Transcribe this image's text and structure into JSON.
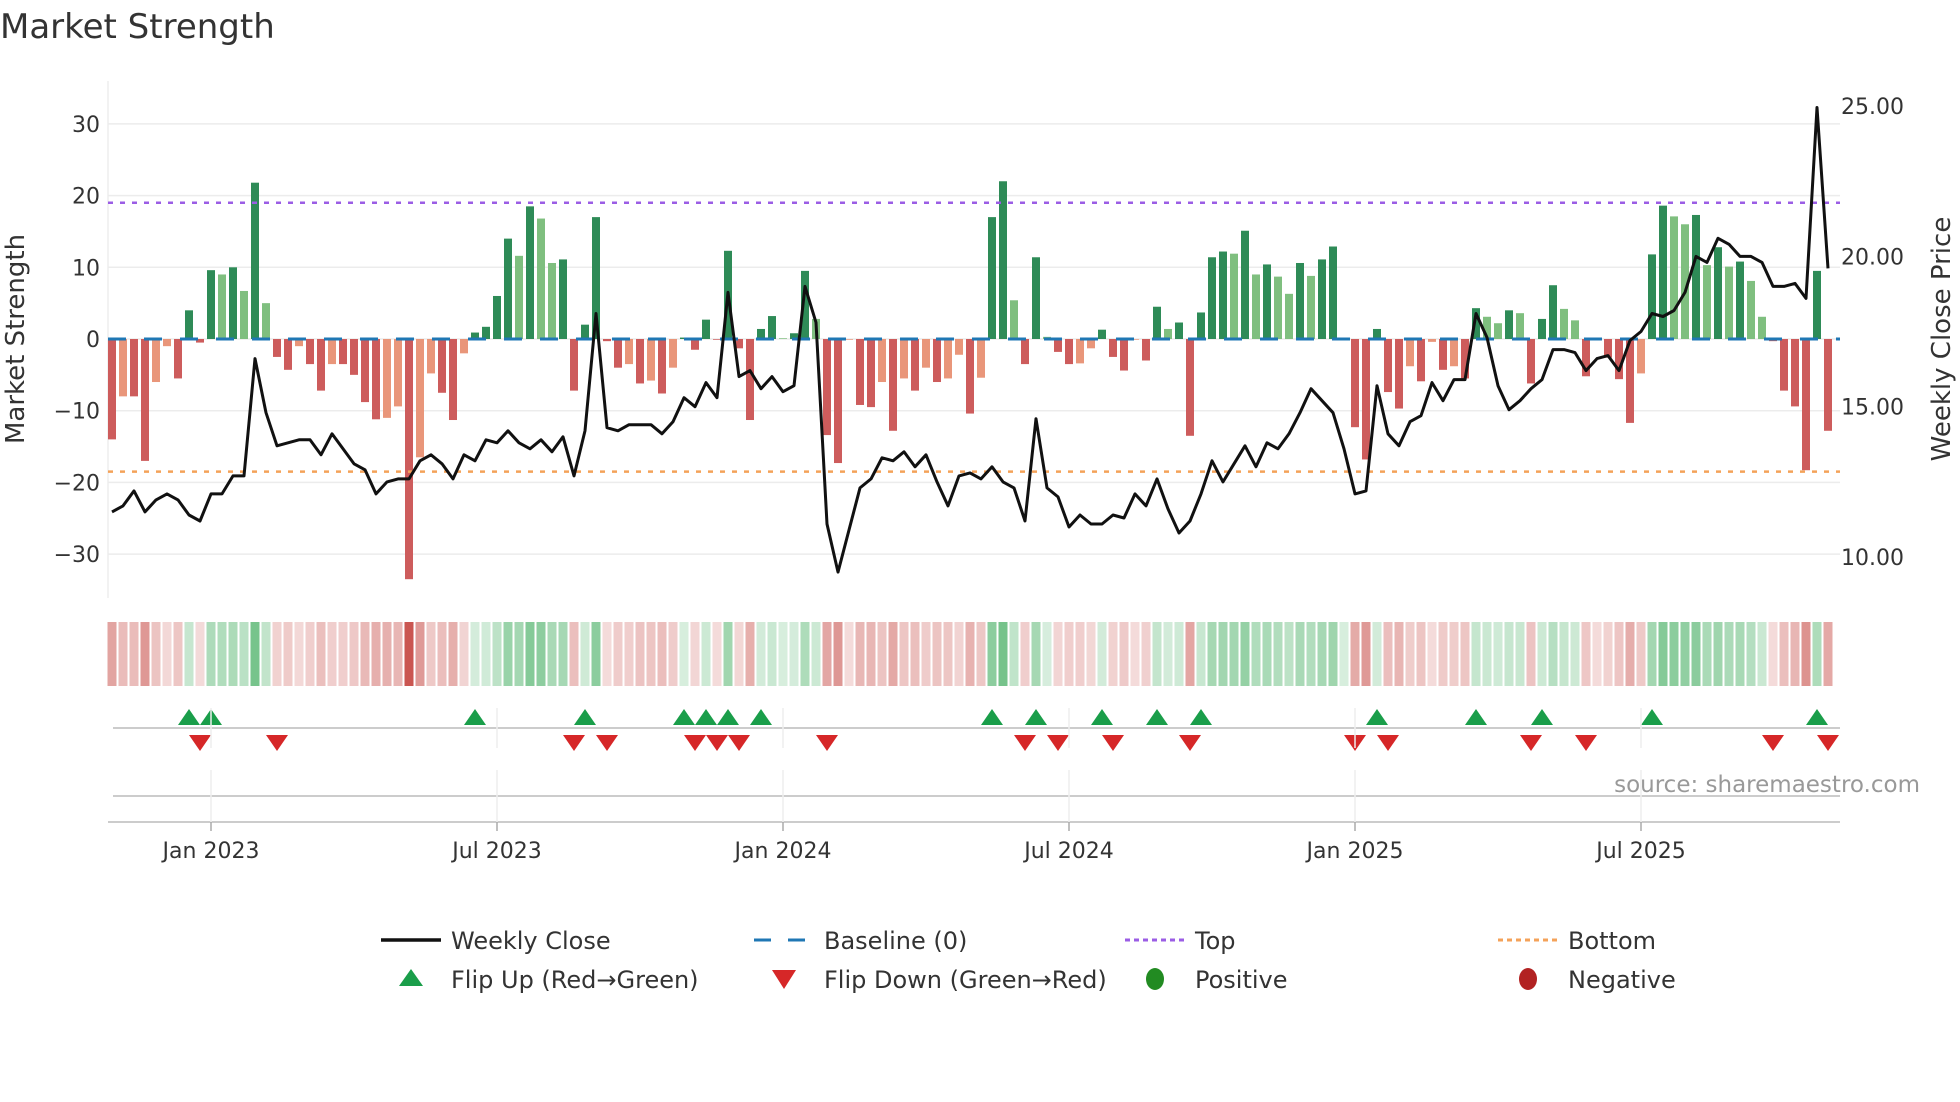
{
  "title": "Market Strength",
  "source": "source: sharemaestro.com",
  "colors": {
    "green_dark": "#2e8b57",
    "green_light": "#7fbf7f",
    "red_dark": "#cd5c5c",
    "red_light": "#e9967a",
    "baseline": "#1f77b4",
    "top": "#9b5de5",
    "bottom": "#f4a259",
    "flip_up": "#1a9e4a",
    "flip_down": "#d62728",
    "positive": "#228b22",
    "negative": "#b22222",
    "close": "#111111"
  },
  "chart_data": {
    "type": "bar+line",
    "title": "Market Strength",
    "ylabel": "Market Strength",
    "y2label": "Weekly Close Price",
    "ylim": [
      -36,
      37
    ],
    "y2lim": [
      8.65,
      26.4
    ],
    "yticks": [
      30,
      20,
      10,
      0,
      -10,
      -20,
      -30
    ],
    "yticklabels": [
      "30",
      "20",
      "10",
      "0",
      "−10",
      "−20",
      "−30"
    ],
    "y2ticks": [
      25,
      20,
      15,
      10
    ],
    "y2ticklabels": [
      "25.00",
      "20.00",
      "15.00",
      "10.00"
    ],
    "xticks": [
      {
        "week": 9,
        "label": "Jan 2023"
      },
      {
        "week": 35,
        "label": "Jul 2023"
      },
      {
        "week": 61,
        "label": "Jan 2024"
      },
      {
        "week": 87,
        "label": "Jul 2024"
      },
      {
        "week": 113,
        "label": "Jan 2025"
      },
      {
        "week": 139,
        "label": "Jul 2025"
      }
    ],
    "top_level": 19,
    "bottom_level": -18.5,
    "baseline": 0,
    "strength": [
      -14,
      -8,
      -8,
      -17,
      -6,
      -1,
      -5.5,
      4,
      -0.5,
      9.6,
      9,
      10,
      6.7,
      21.8,
      5,
      -2.5,
      -4.3,
      -1,
      -3.5,
      -7.2,
      -3.5,
      -3.5,
      -5,
      -8.8,
      -11.2,
      -11,
      -9.4,
      -33.5,
      -16.5,
      -4.8,
      -7.5,
      -11.3,
      -2,
      0.9,
      1.7,
      6,
      14,
      11.6,
      18.5,
      16.8,
      10.6,
      11.1,
      -7.2,
      2,
      17,
      -0.3,
      -4,
      -3.5,
      -6.2,
      -5.8,
      -7.6,
      -4,
      0.2,
      -1.5,
      2.7,
      -0.1,
      12.3,
      -1.3,
      -11.3,
      1.4,
      3.2,
      0.1,
      0.8,
      9.5,
      2.8,
      -13.4,
      -17.3,
      -0.1,
      -9.2,
      -9.5,
      -6,
      -12.8,
      -5.5,
      -7.2,
      -4,
      -6,
      -5.5,
      -2.2,
      -10.4,
      -5.4,
      17,
      22,
      5.4,
      -3.5,
      11.4,
      0.3,
      -1.8,
      -3.5,
      -3.4,
      -1.3,
      1.3,
      -2.5,
      -4.4,
      -0.1,
      -3,
      4.5,
      1.4,
      2.3,
      -13.5,
      3.7,
      11.4,
      12.2,
      11.9,
      15.1,
      9,
      10.4,
      8.7,
      6.3,
      10.6,
      8.8,
      11.1,
      12.9,
      0.2,
      -12.3,
      -16.8,
      1.4,
      -7.4,
      -9.7,
      -3.8,
      -5.9,
      -0.4,
      -4.3,
      -3.8,
      -5.5,
      4.3,
      3.1,
      2.2,
      4,
      3.6,
      -6.2,
      2.8,
      7.5,
      4.2,
      2.6,
      -5.2,
      -0.1,
      -2.6,
      -5.6,
      -11.7,
      -4.8,
      11.8,
      18.6,
      17.1,
      16,
      17.3,
      10.3,
      12.8,
      10.1,
      10.8,
      8.1,
      3.1,
      -0.3,
      -7.2,
      -9.4,
      -18.3,
      9.5,
      -12.8
    ],
    "close": [
      11.5,
      11.7,
      12.2,
      11.5,
      11.9,
      12.1,
      11.9,
      11.4,
      11.2,
      12.1,
      12.1,
      12.7,
      12.7,
      16.6,
      14.8,
      13.7,
      13.8,
      13.9,
      13.9,
      13.4,
      14.1,
      13.6,
      13.1,
      12.9,
      12.1,
      12.5,
      12.6,
      12.6,
      13.2,
      13.4,
      13.1,
      12.6,
      13.4,
      13.2,
      13.9,
      13.8,
      14.2,
      13.8,
      13.6,
      13.9,
      13.5,
      14.0,
      12.7,
      14.2,
      18.1,
      14.3,
      14.2,
      14.4,
      14.4,
      14.4,
      14.1,
      14.5,
      15.3,
      15.0,
      15.8,
      15.3,
      18.8,
      16.0,
      16.2,
      15.6,
      16.0,
      15.5,
      15.7,
      19.0,
      17.8,
      11.1,
      9.5,
      10.9,
      12.3,
      12.6,
      13.3,
      13.2,
      13.5,
      13.0,
      13.4,
      12.5,
      11.7,
      12.7,
      12.8,
      12.6,
      13.0,
      12.5,
      12.3,
      11.2,
      14.6,
      12.3,
      12.0,
      11.0,
      11.4,
      11.1,
      11.1,
      11.4,
      11.3,
      12.1,
      11.7,
      12.6,
      11.6,
      10.8,
      11.2,
      12.1,
      13.2,
      12.5,
      13.1,
      13.7,
      13.0,
      13.8,
      13.6,
      14.1,
      14.8,
      15.6,
      15.2,
      14.8,
      13.6,
      12.1,
      12.2,
      15.7,
      14.1,
      13.7,
      14.5,
      14.7,
      15.8,
      15.2,
      15.9,
      15.9,
      18.1,
      17.3,
      15.7,
      14.9,
      15.2,
      15.6,
      15.9,
      16.9,
      16.9,
      16.8,
      16.2,
      16.6,
      16.7,
      16.2,
      17.2,
      17.5,
      18.1,
      18.0,
      18.2,
      18.8,
      20.0,
      19.8,
      20.6,
      20.4,
      20.0,
      20.0,
      19.8,
      19.0,
      19.0,
      19.1,
      18.6,
      24.95,
      19.6
    ],
    "legend": [
      {
        "label": "Weekly Close",
        "marker": "line"
      },
      {
        "label": "Baseline (0)",
        "marker": "dash"
      },
      {
        "label": "Top",
        "marker": "dot"
      },
      {
        "label": "Bottom",
        "marker": "dot"
      },
      {
        "label": "Flip Up (Red→Green)",
        "marker": "triangle-up"
      },
      {
        "label": "Flip Down (Green→Red)",
        "marker": "triangle-down"
      },
      {
        "label": "Positive",
        "marker": "circle"
      },
      {
        "label": "Negative",
        "marker": "circle"
      }
    ],
    "legend_position": "bottom"
  }
}
